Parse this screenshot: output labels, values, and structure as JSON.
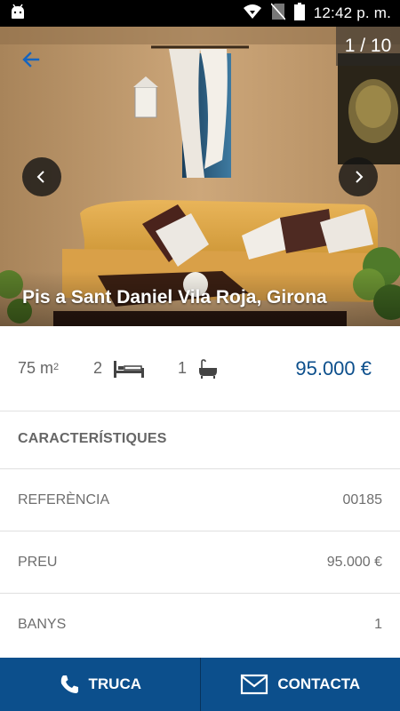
{
  "status_bar": {
    "time": "12:42 p. m.",
    "icons": [
      "android-icon",
      "wifi-icon",
      "no-sim-icon",
      "battery-icon"
    ]
  },
  "gallery": {
    "counter": "1 / 10",
    "title": "Pis a Sant Daniel Vila Roja, Girona"
  },
  "summary": {
    "area_value": "75 m",
    "area_unit_sup": "2",
    "bedrooms": "2",
    "bathrooms": "1",
    "price": "95.000 €"
  },
  "features": {
    "heading": "CARACTERÍSTIQUES",
    "rows": [
      {
        "label": "REFERÈNCIA",
        "value": "00185"
      },
      {
        "label": "PREU",
        "value": "95.000 €"
      },
      {
        "label": "BANYS",
        "value": "1"
      }
    ]
  },
  "actions": {
    "call_label": "TRUCA",
    "contact_label": "CONTACTA"
  },
  "colors": {
    "brand": "#0c4f8c",
    "text_muted": "#666666"
  }
}
